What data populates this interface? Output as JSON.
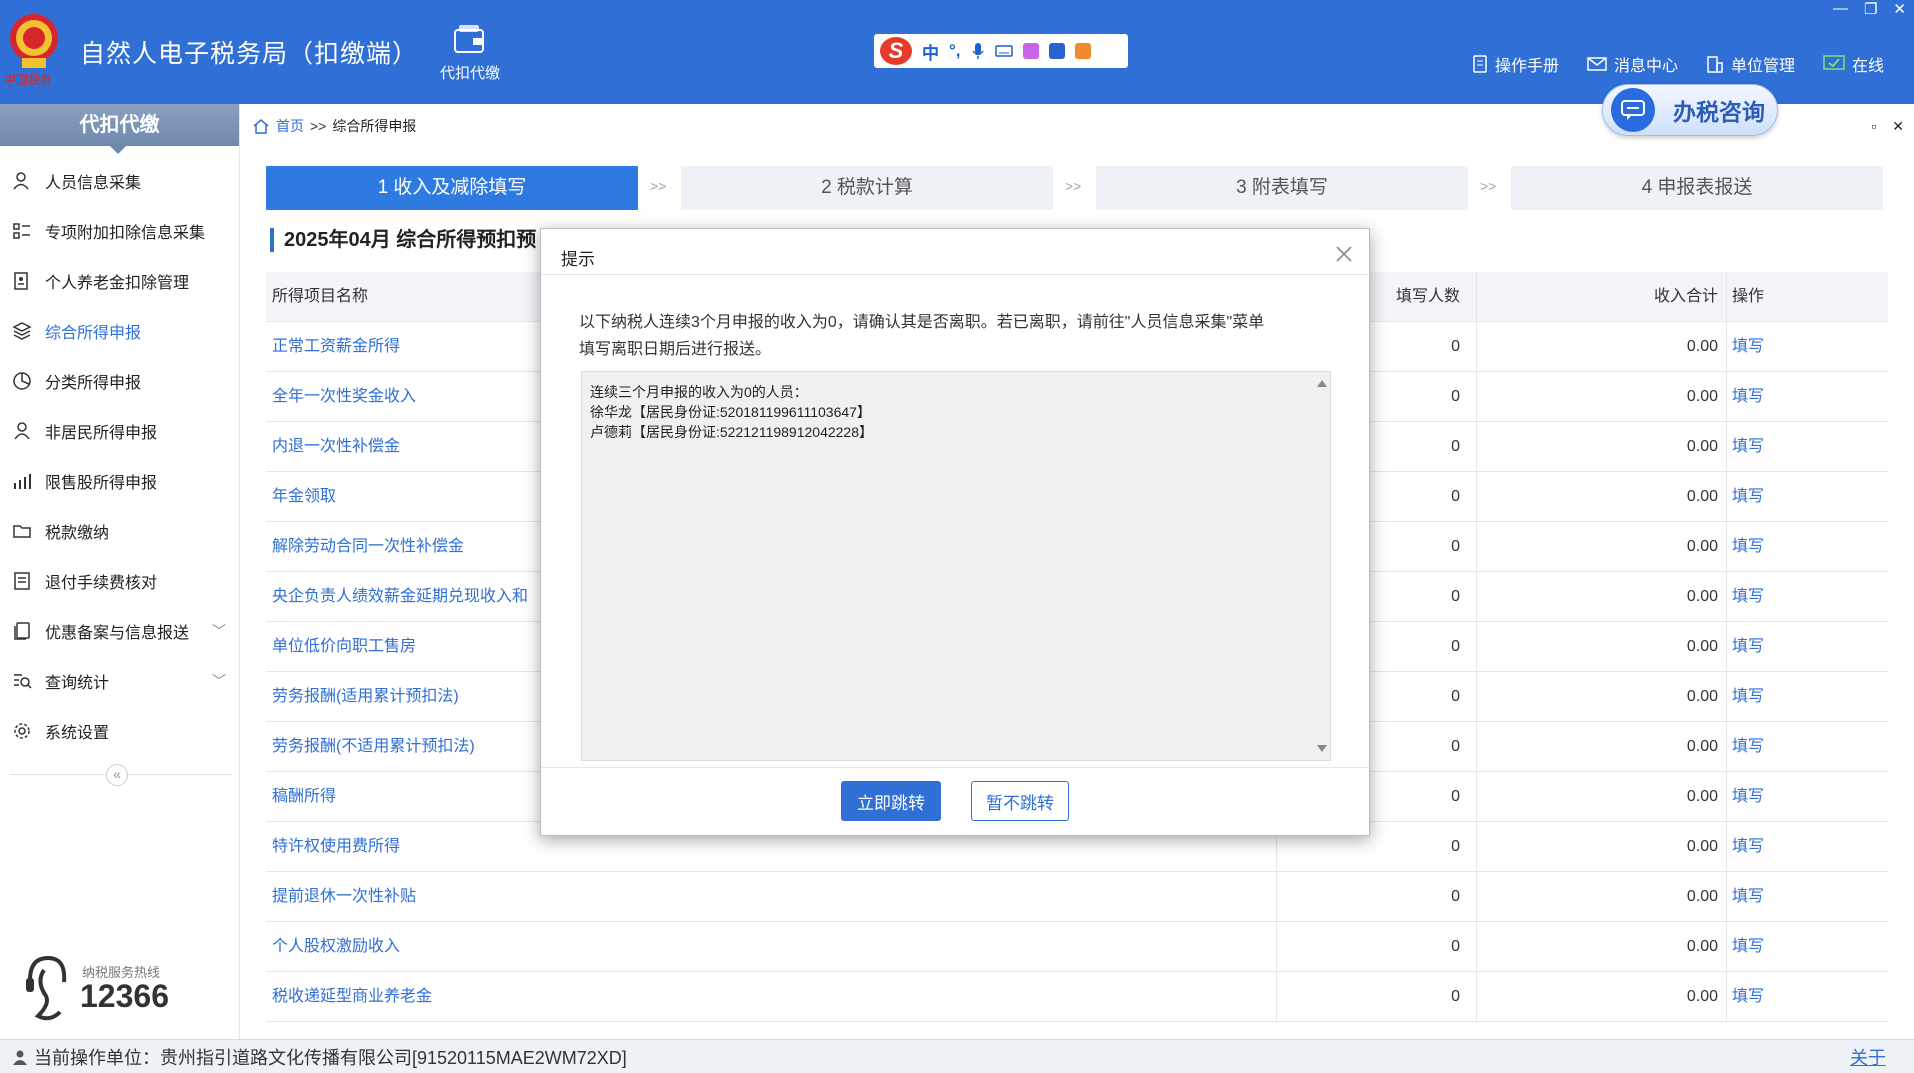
{
  "header": {
    "app_title": "自然人电子税务局（扣缴端）",
    "module_label": "代扣代缴",
    "ime": {
      "lang": "中"
    },
    "links": [
      {
        "label": "操作手册",
        "icon": "manual-icon"
      },
      {
        "label": "消息中心",
        "icon": "mail-icon"
      },
      {
        "label": "单位管理",
        "icon": "building-icon"
      },
      {
        "label": "在线",
        "icon": "monitor-check-icon"
      }
    ],
    "consult_label": "办税咨询",
    "brand_color": "#2f6fd6"
  },
  "sidebar": {
    "title": "代扣代缴",
    "items": [
      {
        "label": "人员信息采集"
      },
      {
        "label": "专项附加扣除信息采集"
      },
      {
        "label": "个人养老金扣除管理"
      },
      {
        "label": "综合所得申报",
        "active": true
      },
      {
        "label": "分类所得申报"
      },
      {
        "label": "非居民所得申报"
      },
      {
        "label": "限售股所得申报"
      },
      {
        "label": "税款缴纳"
      },
      {
        "label": "退付手续费核对"
      },
      {
        "label": "优惠备案与信息报送",
        "expandable": true
      },
      {
        "label": "查询统计",
        "expandable": true
      },
      {
        "label": "系统设置"
      }
    ],
    "hotline_caption": "纳税服务热线",
    "hotline_number": "12366"
  },
  "breadcrumb": {
    "home": "首页",
    "separator": ">>",
    "current": "综合所得申报"
  },
  "steps": [
    {
      "label": "1 收入及减除填写",
      "active": true
    },
    {
      "label": "2 税款计算"
    },
    {
      "label": "3 附表填写"
    },
    {
      "label": "4 申报表报送"
    }
  ],
  "step_separator": ">>",
  "period_title": "2025年04月  综合所得预扣预",
  "table": {
    "headers": {
      "name": "所得项目名称",
      "count": "填写人数",
      "sum": "收入合计",
      "op": "操作"
    },
    "rows": [
      {
        "name": "正常工资薪金所得",
        "count": "0",
        "sum": "0.00",
        "op": "填写"
      },
      {
        "name": "全年一次性奖金收入",
        "count": "0",
        "sum": "0.00",
        "op": "填写"
      },
      {
        "name": "内退一次性补偿金",
        "count": "0",
        "sum": "0.00",
        "op": "填写"
      },
      {
        "name": "年金领取",
        "count": "0",
        "sum": "0.00",
        "op": "填写"
      },
      {
        "name": "解除劳动合同一次性补偿金",
        "count": "0",
        "sum": "0.00",
        "op": "填写"
      },
      {
        "name": "央企负责人绩效薪金延期兑现收入和",
        "count": "0",
        "sum": "0.00",
        "op": "填写"
      },
      {
        "name": "单位低价向职工售房",
        "count": "0",
        "sum": "0.00",
        "op": "填写"
      },
      {
        "name": "劳务报酬(适用累计预扣法)",
        "count": "0",
        "sum": "0.00",
        "op": "填写"
      },
      {
        "name": "劳务报酬(不适用累计预扣法)",
        "count": "0",
        "sum": "0.00",
        "op": "填写"
      },
      {
        "name": "稿酬所得",
        "count": "0",
        "sum": "0.00",
        "op": "填写"
      },
      {
        "name": "特许权使用费所得",
        "count": "0",
        "sum": "0.00",
        "op": "填写"
      },
      {
        "name": "提前退休一次性补贴",
        "count": "0",
        "sum": "0.00",
        "op": "填写"
      },
      {
        "name": "个人股权激励收入",
        "count": "0",
        "sum": "0.00",
        "op": "填写"
      },
      {
        "name": "税收递延型商业养老金",
        "count": "0",
        "sum": "0.00",
        "op": "填写"
      }
    ]
  },
  "status_bar": {
    "label": "当前操作单位：",
    "unit": "贵州指引道路文化传播有限公司[91520115MAE2WM72XD]",
    "close_label": "关于"
  },
  "modal": {
    "title": "提示",
    "message_line1": "以下纳税人连续3个月申报的收入为0，请确认其是否离职。若已离职，请前往\"人员信息采集\"菜单",
    "message_line2": "填写离职日期后进行报送。",
    "list_heading": "连续三个月申报的收入为0的人员：",
    "persons": [
      "徐华龙【居民身份证:520181199611103647】",
      "卢德莉【居民身份证:522121198912042228】"
    ],
    "confirm_label": "立即跳转",
    "cancel_label": "暂不跳转"
  }
}
